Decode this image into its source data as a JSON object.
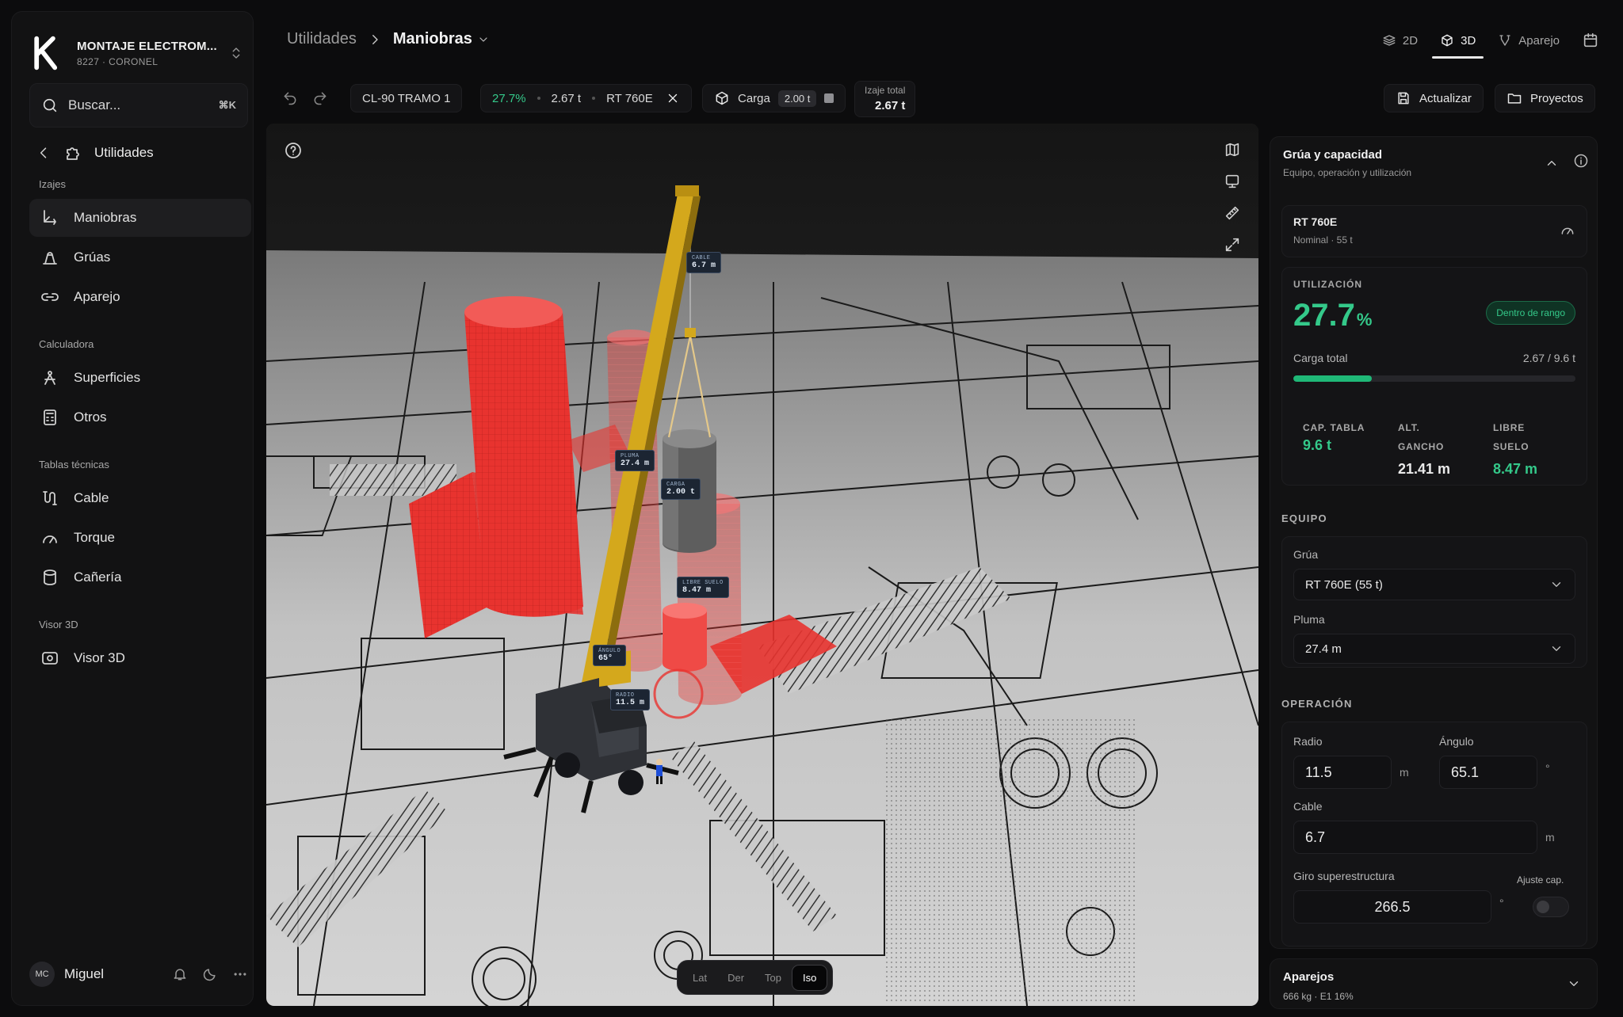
{
  "sidebar": {
    "org_name": "MONTAJE ELECTROM...",
    "org_sub": "8227 · CORONEL",
    "search_placeholder": "Buscar...",
    "search_shortcut": "⌘K",
    "back_label": "Utilidades",
    "sections": {
      "izajes": "Izajes",
      "calculadora": "Calculadora",
      "tablas": "Tablas técnicas",
      "visor": "Visor 3D"
    },
    "items": [
      {
        "label": "Maniobras",
        "icon": "maneuver-icon",
        "active": true
      },
      {
        "label": "Grúas",
        "icon": "crane-icon"
      },
      {
        "label": "Aparejo",
        "icon": "link-icon"
      },
      {
        "label": "Superficies",
        "icon": "surface-icon"
      },
      {
        "label": "Otros",
        "icon": "calculator-icon"
      },
      {
        "label": "Cable",
        "icon": "cable-icon"
      },
      {
        "label": "Torque",
        "icon": "gauge-icon"
      },
      {
        "label": "Cañería",
        "icon": "pipe-icon"
      },
      {
        "label": "Visor 3D",
        "icon": "viewer-icon"
      }
    ],
    "user_initials": "MC",
    "user_name": "Miguel"
  },
  "header": {
    "crumb_parent": "Utilidades",
    "crumb_current": "Maniobras",
    "tabs": [
      {
        "label": "2D",
        "icon": "layers-icon"
      },
      {
        "label": "3D",
        "icon": "cube-icon",
        "active": true
      },
      {
        "label": "Aparejo",
        "icon": "rigging-icon"
      }
    ]
  },
  "toolbar": {
    "project": "CL-90 TRAMO 1",
    "utilization": "27.7%",
    "total_weight": "2.67 t",
    "crane": "RT 760E",
    "load_label": "Carga",
    "load_value": "2.00 t",
    "izaje_label": "Izaje total",
    "izaje_value": "2.67 t",
    "update_label": "Actualizar",
    "projects_label": "Proyectos"
  },
  "viewport": {
    "labels": {
      "cable": {
        "k": "CABLE",
        "v": "6.7 m"
      },
      "pluma": {
        "k": "PLUMA",
        "v": "27.4 m"
      },
      "carga": {
        "k": "CARGA",
        "v": "2.00 t"
      },
      "libre": {
        "k": "LIBRE SUELO",
        "v": "8.47 m"
      },
      "angulo": {
        "k": "ÁNGULO",
        "v": "65°"
      },
      "radio": {
        "k": "RADIO",
        "v": "11.5 m"
      }
    },
    "camera_views": [
      "Lat",
      "Der",
      "Top",
      "Iso"
    ],
    "camera_active": "Iso",
    "colors": {
      "obstacle": "#e8332f",
      "boom": "#d4a81c",
      "load": "#6a6a6a"
    }
  },
  "panel": {
    "title": "Grúa y capacidad",
    "subtitle": "Equipo, operación y utilización",
    "crane_name": "RT 760E",
    "crane_nominal": "Nominal · 55 t",
    "util_label": "UTILIZACIÓN",
    "util_value": "27.7",
    "util_unit": "%",
    "util_fraction": 0.277,
    "util_badge": "Dentro de rango",
    "carga_total_label": "Carga total",
    "carga_total_value": "2.67 / 9.6 t",
    "stats": [
      {
        "label_1": "CAP. TABLA",
        "label_2": "",
        "value": "9.6 t"
      },
      {
        "label_1": "ALT.",
        "label_2": "GANCHO",
        "value": "21.41 m"
      },
      {
        "label_1": "LIBRE",
        "label_2": "SUELO",
        "value": "8.47 m"
      }
    ],
    "equipo_header": "EQUIPO",
    "grua_label": "Grúa",
    "grua_value": "RT 760E (55 t)",
    "pluma_label": "Pluma",
    "pluma_value": "27.4 m",
    "operacion_header": "OPERACIÓN",
    "radio_label": "Radio",
    "radio_value": "11.5",
    "radio_unit": "m",
    "angulo_label": "Ángulo",
    "angulo_value": "65.1",
    "angulo_unit": "°",
    "cable_label": "Cable",
    "cable_value": "6.7",
    "cable_unit": "m",
    "giro_label": "Giro superestructura",
    "giro_value": "266.5",
    "giro_unit": "°",
    "ajuste_label": "Ajuste cap."
  },
  "aparejos": {
    "title": "Aparejos",
    "subtitle": "666 kg · E1 16%"
  }
}
